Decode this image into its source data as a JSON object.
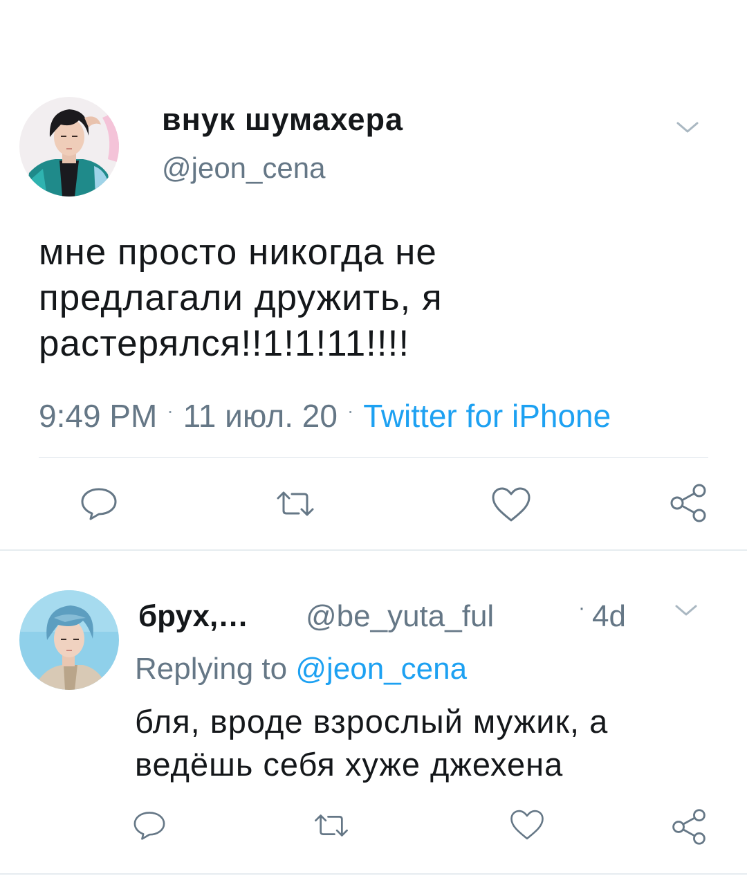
{
  "tweet": {
    "display_name": "внук шумахера",
    "handle": "@jeon_cena",
    "text": "мне просто никогда не\nпредлагали дружить, я\nрастерялся!!1!1!11!!!!",
    "time": "9:49 PM",
    "date": "11 июл. 20",
    "source": "Twitter for iPhone",
    "avatar_icon": "profile-photo",
    "menu_icon": "chevron-down-icon",
    "actions": [
      {
        "name": "reply",
        "icon": "speech-bubble-icon"
      },
      {
        "name": "retweet",
        "icon": "retweet-arrows-icon"
      },
      {
        "name": "like",
        "icon": "heart-icon"
      },
      {
        "name": "share",
        "icon": "share-nodes-icon"
      }
    ]
  },
  "reply": {
    "display_name": "брух,…",
    "handle": "@be_yuta_ful",
    "age": "4d",
    "replying_prefix": "Replying to ",
    "replying_to": "@jeon_cena",
    "text": "бля, вроде взрослый мужик, а\nведёшь себя хуже джехена",
    "avatar_icon": "profile-photo",
    "menu_icon": "chevron-down-icon"
  },
  "colors": {
    "text": "#14171a",
    "secondary": "#657786",
    "link": "#1da1f2",
    "divider": "#e1e8ed"
  }
}
